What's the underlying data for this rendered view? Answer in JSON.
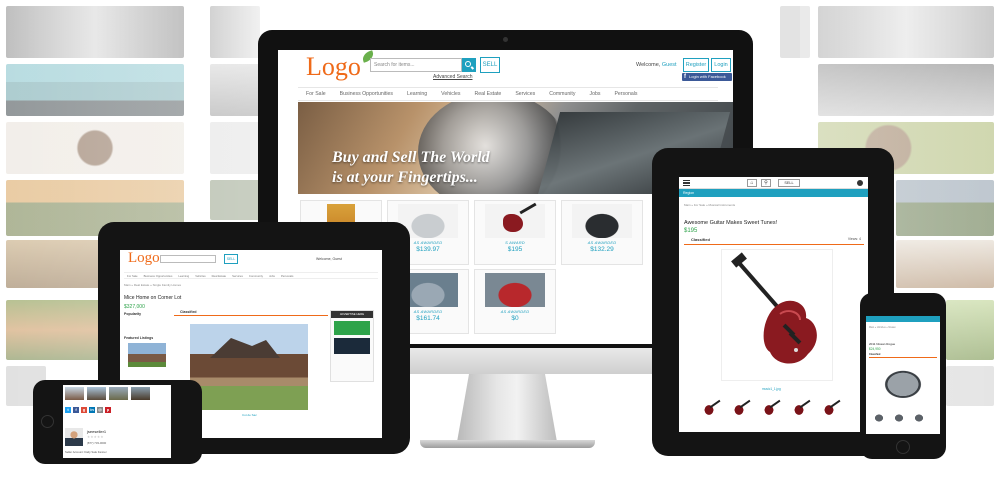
{
  "site": {
    "logo": "Logo",
    "search_placeholder": "Search for items...",
    "sell_label": "SELL",
    "advanced_search": "Advanced Search",
    "welcome_prefix": "Welcome,",
    "welcome_user": "Guest",
    "register_label": "Register",
    "login_label": "Login",
    "facebook_login": "Login with Facebook",
    "nav": [
      "For Sale",
      "Business Opportunities",
      "Learning",
      "Vehicles",
      "Real Estate",
      "Services",
      "Community",
      "Jobs",
      "Personals"
    ],
    "hero_text_line1": "Buy and Sell The World",
    "hero_text_line2": "is at your Fingertips..."
  },
  "listings": [
    {
      "thumb": "book",
      "condition": "",
      "price": ""
    },
    {
      "thumb": "car-silver",
      "condition": "AS AWARDED",
      "price": "$139.97"
    },
    {
      "thumb": "guitar",
      "condition": "S AWARD",
      "price": "$195"
    },
    {
      "thumb": "car-black",
      "condition": "AS AWARDED",
      "price": "$132.29"
    },
    {
      "thumb": "car-silver",
      "condition": "AS AWARDED",
      "price": "$0"
    },
    {
      "thumb": "car-parking",
      "condition": "AS AWARDED",
      "price": "$161.74"
    },
    {
      "thumb": "car-red",
      "condition": "AS AWARDED",
      "price": "$0"
    }
  ],
  "tablet_left": {
    "logo": "Logo",
    "sell": "SELL",
    "welcome": "Welcome, Guest",
    "nav": [
      "For Sale",
      "Business Opportunities",
      "Learning",
      "Vehicles",
      "Real Estate",
      "Services",
      "Community",
      "Jobs",
      "Personals"
    ],
    "breadcrumb": "Main » Real Estate » Single Family Homes",
    "title": "Mice Home on Corner Lot",
    "price": "$327,000",
    "classified": "Classified",
    "popularity": "Popularity",
    "featured": "Featured Listings",
    "caption": "Cut de Sac",
    "ad_head": "ADVERTISE HERE"
  },
  "tablet_right": {
    "region": "Region",
    "sell": "SELL",
    "breadcrumb": "Main » For Sale » Musical Instruments",
    "title": "Awesome Guitar Makes Sweet Tunes!",
    "price": "$195",
    "classified": "Classified",
    "views": "Views: 4",
    "caption": "music1_1.jpg"
  },
  "phone_right": {
    "breadcrumb": "Main » Vehicles » Nissan",
    "title": "2011 Nissan Rogue",
    "price": "$24,950",
    "classified": "Classified"
  },
  "phone_left": {
    "name": "jseeseller1",
    "stars": "★★★★★",
    "phone": "(877) 733-0000",
    "account": "Seller Account: Daily Sale Fanner"
  }
}
